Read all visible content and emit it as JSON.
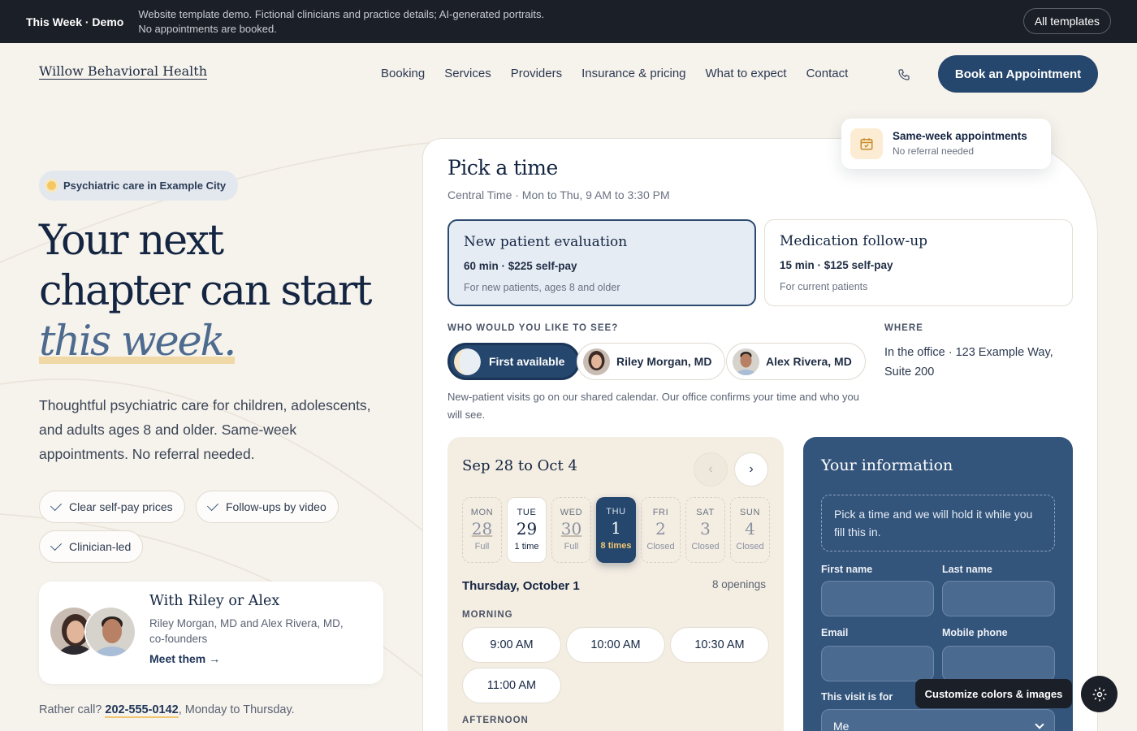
{
  "demo_bar": {
    "brand": "This Week · Demo",
    "note_line1": "Website template demo. Fictional clinicians and practice details; AI-generated portraits.",
    "note_line2": "No appointments are booked.",
    "all_templates": "All templates"
  },
  "header": {
    "logo": "Willow Behavioral Health",
    "nav": [
      "Booking",
      "Services",
      "Providers",
      "Insurance & pricing",
      "What to expect",
      "Contact"
    ],
    "phone_icon": "phone-icon",
    "cta": "Book an Appointment"
  },
  "hero": {
    "eyebrow": "Psychiatric care in Example City",
    "title_line1": "Your next",
    "title_line2": "chapter can start",
    "title_em": "this week.",
    "lead": "Thoughtful psychiatric care for children, adolescents, and adults ages 8 and older. Same-week appointments. No referral needed.",
    "chips": [
      "Clear self-pay prices",
      "Follow-ups by video",
      "Clinician-led"
    ],
    "team_title": "With Riley or Alex",
    "team_sub": "Riley Morgan, MD and Alex Rivera, MD, co-founders",
    "team_link": "Meet them",
    "call_prefix": "Rather call?",
    "call_number": "202-555-0142",
    "call_suffix": ", Monday to Thursday."
  },
  "badge": {
    "title": "Same-week appointments",
    "subtitle": "No referral needed",
    "icon": "calendar-check-icon"
  },
  "booking": {
    "title": "Pick a time",
    "subtitle": "Central Time · Mon to Thu, 9 AM to 3:30 PM",
    "visit_types": [
      {
        "name": "New patient evaluation",
        "price": "60 min · $225 self-pay",
        "desc": "For new patients, ages 8 and older",
        "selected": true
      },
      {
        "name": "Medication follow-up",
        "price": "15 min · $125 self-pay",
        "desc": "For current patients",
        "selected": false
      }
    ],
    "who_label": "WHO WOULD YOU LIKE TO SEE?",
    "providers": [
      "First available",
      "Riley Morgan, MD",
      "Alex Rivera, MD"
    ],
    "provider_note": "New-patient visits go on our shared calendar. Our office confirms your time and who you will see.",
    "where_label": "WHERE",
    "where_value": "In the office · 123 Example Way, Suite 200"
  },
  "calendar": {
    "range": "Sep 28 to Oct 4",
    "prev": "‹",
    "next": "›",
    "days": [
      {
        "dow": "MON",
        "num": "28",
        "status": "Full",
        "state": "full"
      },
      {
        "dow": "TUE",
        "num": "29",
        "status": "1 time",
        "state": "avail"
      },
      {
        "dow": "WED",
        "num": "30",
        "status": "Full",
        "state": "full"
      },
      {
        "dow": "THU",
        "num": "1",
        "status": "8 times",
        "state": "sel"
      },
      {
        "dow": "FRI",
        "num": "2",
        "status": "Closed",
        "state": "closed"
      },
      {
        "dow": "SAT",
        "num": "3",
        "status": "Closed",
        "state": "closed"
      },
      {
        "dow": "SUN",
        "num": "4",
        "status": "Closed",
        "state": "closed"
      }
    ],
    "selected_date": "Thursday, October 1",
    "openings": "8 openings",
    "morning_label": "MORNING",
    "morning_slots": [
      "9:00 AM",
      "10:00 AM",
      "10:30 AM",
      "11:00 AM"
    ],
    "afternoon_label": "AFTERNOON"
  },
  "info": {
    "title": "Your information",
    "note": "Pick a time and we will hold it while you fill this in.",
    "first_name": "First name",
    "last_name": "Last name",
    "email": "Email",
    "phone": "Mobile phone",
    "visit_for": "This visit is for",
    "visit_for_value": "Me"
  },
  "customize": {
    "label": "Customize colors & images",
    "icon": "gear-icon"
  },
  "colors": {
    "navy": "#25466d",
    "panel": "#33547b",
    "cream": "#f6f2ec",
    "accent": "#f1c670"
  }
}
